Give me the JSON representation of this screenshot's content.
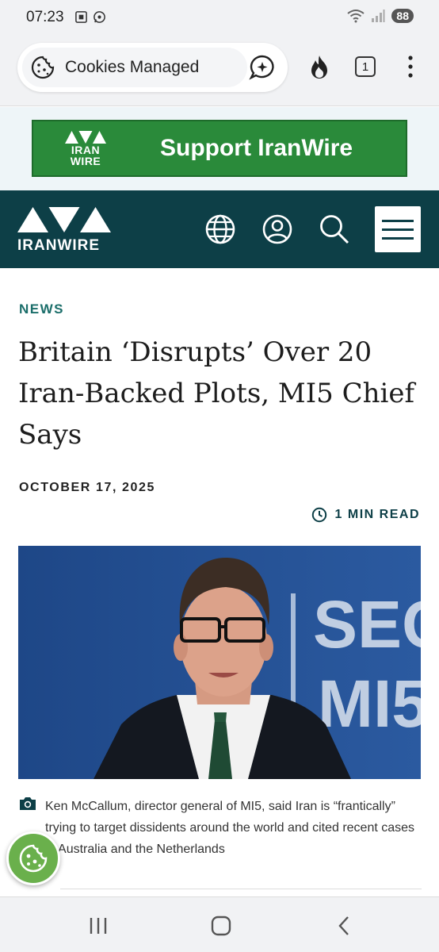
{
  "status_bar": {
    "time": "07:23",
    "battery": "88",
    "icons": [
      "screenshot-icon",
      "whatsapp-icon",
      "wifi-icon",
      "signal-icon"
    ]
  },
  "browser": {
    "cookie_label": "Cookies Managed",
    "tab_count": "1",
    "icons": [
      "cookie-icon",
      "assistant-chat-icon",
      "flame-icon",
      "tabs-icon",
      "more-vert-icon"
    ]
  },
  "ad": {
    "logo_line1": "IRAN",
    "logo_line2": "WIRE",
    "text": "Support IranWire",
    "color": "#2a8a3a"
  },
  "site": {
    "brand": "IRANWIRE",
    "header_color": "#0d3f47",
    "icons": [
      "globe-icon",
      "account-icon",
      "search-icon",
      "menu-icon"
    ]
  },
  "article": {
    "kicker": "NEWS",
    "headline": "Britain ‘Disrupts’ Over 20 Iran-Backed Plots, MI5 Chief Says",
    "date": "OCTOBER 17, 2025",
    "read_time": "1 MIN READ",
    "photo_sign_line1": "SEC",
    "photo_sign_line2": "MI5",
    "caption": "Ken McCallum, director general of MI5, said Iran is “frantically” trying to target dissidents around the world and cited recent cases in Australia and the Netherlands",
    "accent_color": "#1b6e6a"
  },
  "nav_bar": {
    "icons": [
      "recent-apps-icon",
      "home-icon",
      "back-icon"
    ]
  }
}
